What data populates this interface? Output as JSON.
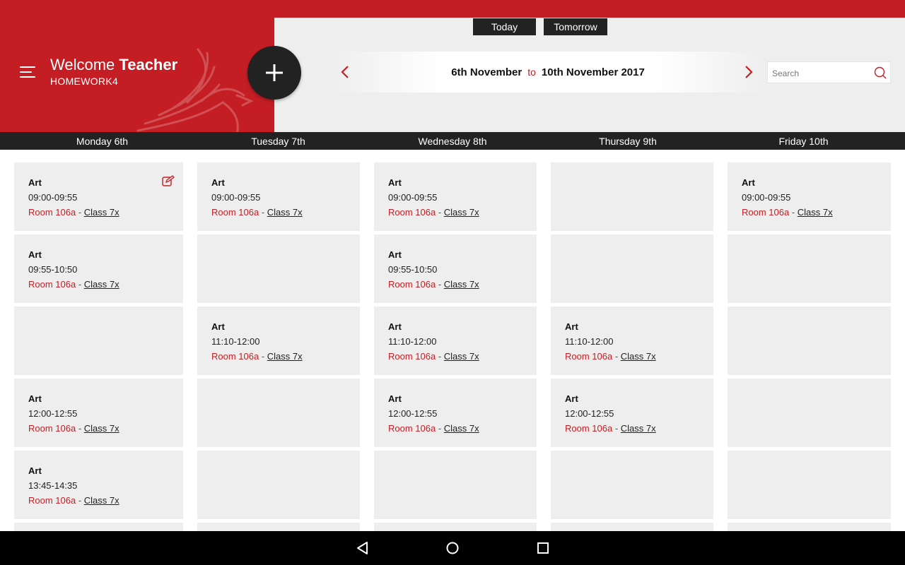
{
  "header": {
    "welcome_prefix": "Welcome",
    "welcome_name": "Teacher",
    "org": "HOMEWORK4",
    "accent_color": "#c41e24",
    "dark_color": "#222222"
  },
  "quick_nav": {
    "today": "Today",
    "tomorrow": "Tomorrow"
  },
  "date_range": {
    "start": "6th November",
    "separator": "to",
    "end": "10th November 2017"
  },
  "search": {
    "placeholder": "Search",
    "value": ""
  },
  "days": [
    "Monday 6th",
    "Tuesday 7th",
    "Wednesday 8th",
    "Thursday 9th",
    "Friday 10th"
  ],
  "lessons": {
    "mon_0": {
      "subject": "Art",
      "time": "09:00-09:55",
      "room": "Room 106a",
      "sep": " - ",
      "class": "Class 7x"
    },
    "mon_1": {
      "subject": "Art",
      "time": "09:55-10:50",
      "room": "Room 106a",
      "sep": " - ",
      "class": "Class 7x"
    },
    "mon_3": {
      "subject": "Art",
      "time": "12:00-12:55",
      "room": "Room 106a",
      "sep": " - ",
      "class": "Class 7x"
    },
    "mon_4": {
      "subject": "Art",
      "time": "13:45-14:35",
      "room": "Room 106a",
      "sep": " - ",
      "class": "Class 7x"
    },
    "tue_0": {
      "subject": "Art",
      "time": "09:00-09:55",
      "room": "Room 106a",
      "sep": " - ",
      "class": "Class 7x"
    },
    "tue_2": {
      "subject": "Art",
      "time": "11:10-12:00",
      "room": "Room 106a",
      "sep": " - ",
      "class": "Class 7x"
    },
    "wed_0": {
      "subject": "Art",
      "time": "09:00-09:55",
      "room": "Room 106a",
      "sep": " - ",
      "class": "Class 7x"
    },
    "wed_1": {
      "subject": "Art",
      "time": "09:55-10:50",
      "room": "Room 106a",
      "sep": " - ",
      "class": "Class 7x"
    },
    "wed_2": {
      "subject": "Art",
      "time": "11:10-12:00",
      "room": "Room 106a",
      "sep": " - ",
      "class": "Class 7x"
    },
    "wed_3": {
      "subject": "Art",
      "time": "12:00-12:55",
      "room": "Room 106a",
      "sep": " - ",
      "class": "Class 7x"
    },
    "thu_2": {
      "subject": "Art",
      "time": "11:10-12:00",
      "room": "Room 106a",
      "sep": " - ",
      "class": "Class 7x"
    },
    "thu_3": {
      "subject": "Art",
      "time": "12:00-12:55",
      "room": "Room 106a",
      "sep": " - ",
      "class": "Class 7x"
    },
    "fri_0": {
      "subject": "Art",
      "time": "09:00-09:55",
      "room": "Room 106a",
      "sep": " - ",
      "class": "Class 7x"
    }
  },
  "icons": {
    "menu": "hamburger-icon",
    "add": "plus-icon",
    "prev": "chevron-left-icon",
    "next": "chevron-right-icon",
    "search": "search-icon",
    "edit": "edit-icon",
    "back": "back-triangle-icon",
    "home": "home-circle-icon",
    "recents": "recents-square-icon"
  }
}
